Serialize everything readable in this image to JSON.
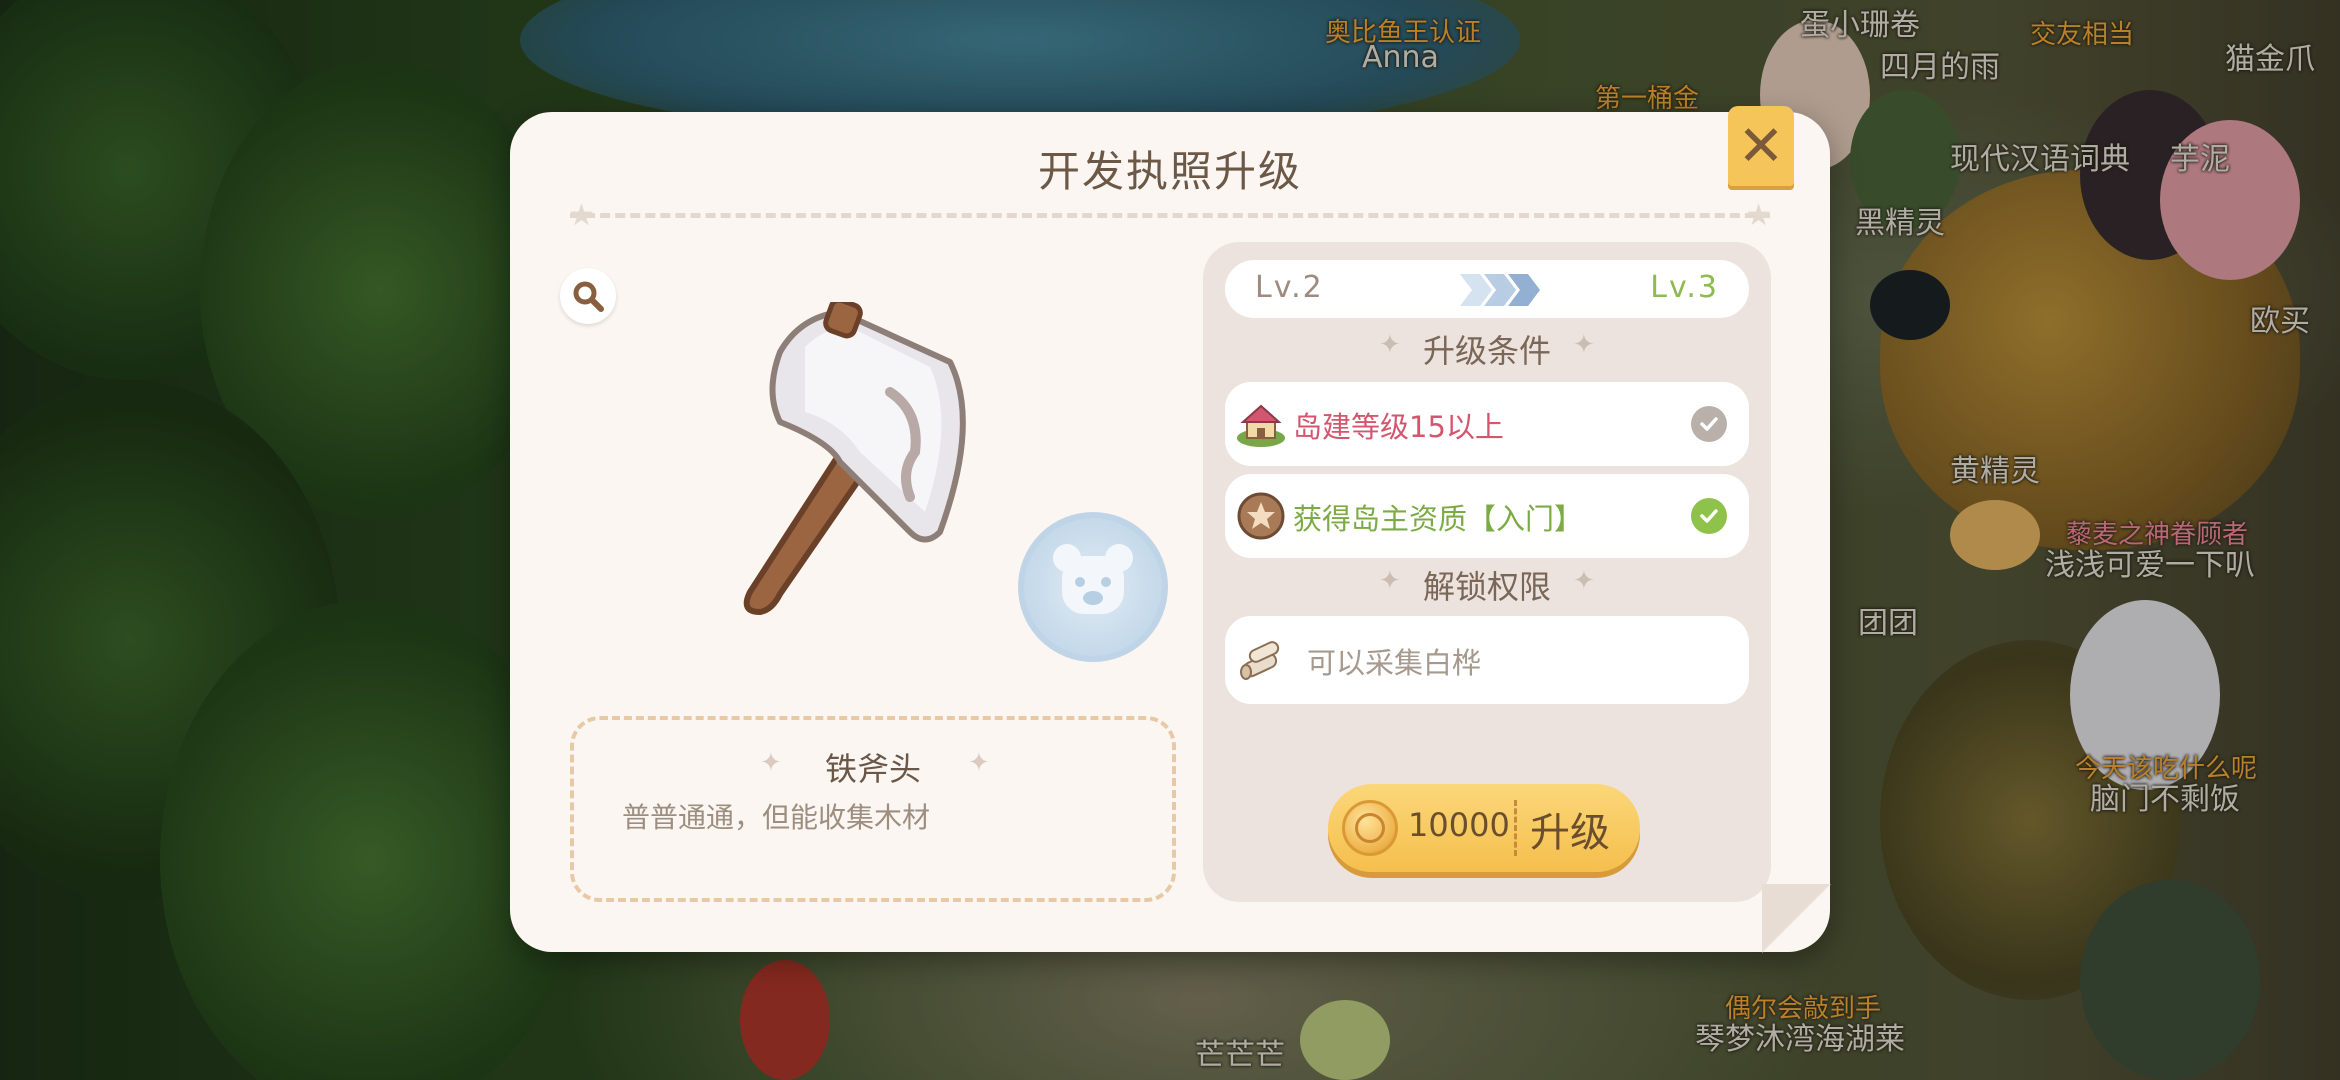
{
  "background": {
    "labels": [
      {
        "text": "奥比鱼王认证",
        "style": "gold"
      },
      {
        "text": "Anna",
        "style": "white"
      },
      {
        "text": "第一桶金",
        "style": "gold"
      },
      {
        "text": "蛋小珊卷",
        "style": "white"
      },
      {
        "text": "交友相当",
        "style": "gold"
      },
      {
        "text": "四月的雨",
        "style": "white"
      },
      {
        "text": "猫金爪",
        "style": "white"
      },
      {
        "text": "现代汉语词典",
        "style": "white"
      },
      {
        "text": "芋泥",
        "style": "white"
      },
      {
        "text": "黑精灵",
        "style": "white"
      },
      {
        "text": "黄精灵",
        "style": "white"
      },
      {
        "text": "藜麦之神眷顾者",
        "style": "pink"
      },
      {
        "text": "浅浅可爱一下叭",
        "style": "white"
      },
      {
        "text": "团团",
        "style": "white"
      },
      {
        "text": "今天该吃什么呢",
        "style": "gold"
      },
      {
        "text": "脑门不剩饭",
        "style": "white"
      },
      {
        "text": "偶尔会敲到手",
        "style": "gold"
      },
      {
        "text": "琴梦沐湾海湖莱",
        "style": "white"
      },
      {
        "text": "芒芒芒",
        "style": "white"
      },
      {
        "text": "欧买",
        "style": "white"
      }
    ]
  },
  "dialog": {
    "title": "开发执照升级",
    "close_icon": "close-icon",
    "item": {
      "name": "铁斧头",
      "description": "普普通通，但能收集木材",
      "image_icon": "axe-icon",
      "badge_icon": "bear-badge-icon"
    },
    "level": {
      "current": "Lv.2",
      "next": "Lv.3",
      "current_color": "#9c8b7e",
      "next_color": "#8dbb4d"
    },
    "conditions": {
      "heading": "升级条件",
      "items": [
        {
          "text": "岛建等级15以上",
          "icon": "island-house-icon",
          "met": true,
          "check_color": "#b9b0aa",
          "text_color": "#d4566e"
        },
        {
          "text": "获得岛主资质【入门】",
          "icon": "cookie-medal-icon",
          "met": true,
          "check_color": "#8fc24a",
          "text_color": "#7cab45"
        }
      ]
    },
    "unlocks": {
      "heading": "解锁权限",
      "items": [
        {
          "text": "可以采集白桦",
          "icon": "log-icon",
          "text_color": "#a6998e"
        }
      ]
    },
    "upgrade": {
      "cost": "10000",
      "label": "升级",
      "currency_icon": "coin-icon"
    }
  }
}
